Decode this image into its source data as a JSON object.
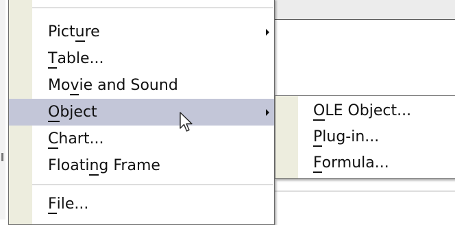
{
  "menu": {
    "items": [
      {
        "pre": "Pict",
        "key": "u",
        "post": "re",
        "submenu": true,
        "highlighted": false
      },
      {
        "pre": "",
        "key": "T",
        "post": "able...",
        "submenu": false,
        "highlighted": false
      },
      {
        "pre": "Mo",
        "key": "v",
        "post": "ie and Sound",
        "submenu": false,
        "highlighted": false
      },
      {
        "pre": "",
        "key": "O",
        "post": "bject",
        "submenu": true,
        "highlighted": true
      },
      {
        "pre": "",
        "key": "C",
        "post": "hart...",
        "submenu": false,
        "highlighted": false
      },
      {
        "pre": "Floati",
        "key": "n",
        "post": "g Frame",
        "submenu": false,
        "highlighted": false
      },
      {
        "pre": "",
        "key": "F",
        "post": "ile...",
        "submenu": false,
        "highlighted": false
      }
    ]
  },
  "submenu": {
    "items": [
      {
        "pre": "",
        "key": "O",
        "post": "LE Object..."
      },
      {
        "pre": "",
        "key": "P",
        "post": "lug-in..."
      },
      {
        "pre": "",
        "key": "F",
        "post": "ormula..."
      }
    ]
  },
  "colors": {
    "highlight": "#c3c6d8",
    "side_strip": "#ededde"
  },
  "icons": {
    "submenu_indicator": "submenu-arrow-icon",
    "pointer": "mouse-pointer-icon"
  }
}
